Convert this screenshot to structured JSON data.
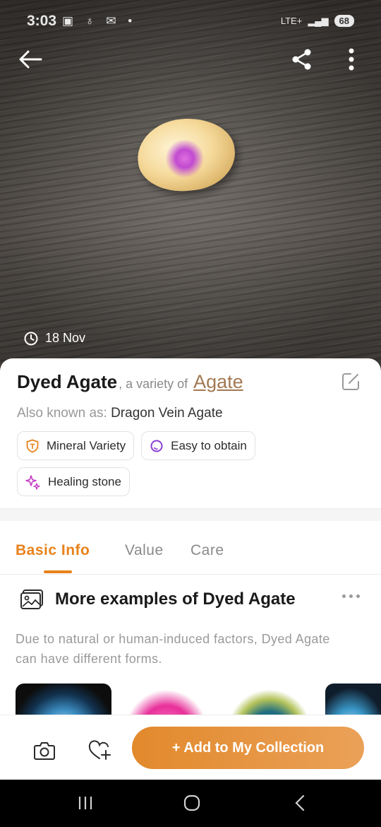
{
  "status_bar": {
    "time": "3:03",
    "notification_icons": [
      "screenshot-icon",
      "accessibility-icon",
      "gmail-icon",
      "dot-icon"
    ],
    "network": "LTE+",
    "battery": "68"
  },
  "hero": {
    "date_label": "18 Nov"
  },
  "header_buttons": {
    "back_icon": "arrow-left-icon",
    "share_icon": "share-icon",
    "more_icon": "more-vertical-icon"
  },
  "specimen": {
    "name": "Dyed Agate",
    "variety_prefix": ", a variety of",
    "parent": "Agate",
    "aka_label": "Also known as:",
    "aka_value": "Dragon Vein Agate",
    "tags": [
      {
        "label": "Mineral Variety",
        "icon": "shield-gem-icon",
        "color": "#e8821a"
      },
      {
        "label": "Easy to obtain",
        "icon": "circle-ring-icon",
        "color": "#8a3fd1"
      },
      {
        "label": "Healing stone",
        "icon": "sparkles-icon",
        "color": "#c43bc4"
      }
    ]
  },
  "tabs": [
    {
      "label": "Basic Info",
      "active": true
    },
    {
      "label": "Value",
      "active": false
    },
    {
      "label": "Care",
      "active": false
    }
  ],
  "examples": {
    "title": "More examples of Dyed Agate",
    "description": "Due to natural or human-induced factors, Dyed Agate can have different forms."
  },
  "actions": {
    "camera_icon": "camera-icon",
    "favorite_icon": "heart-plus-icon",
    "add_label": "+ Add to My Collection"
  },
  "colors": {
    "accent": "#e8821a",
    "link": "#a27952"
  }
}
